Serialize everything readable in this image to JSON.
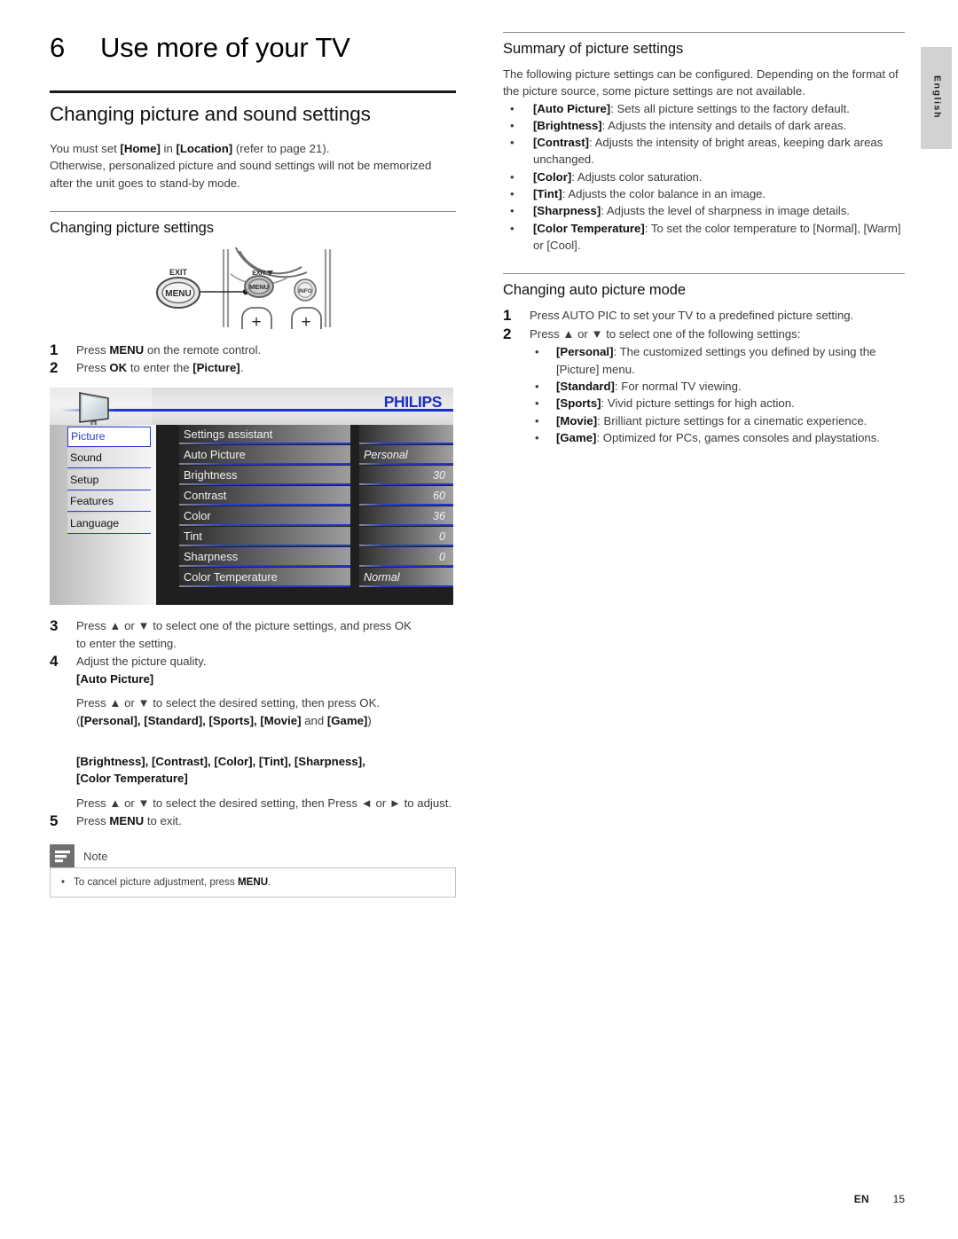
{
  "chapter": {
    "number": "6",
    "title": "Use more of your TV"
  },
  "left": {
    "section_heading": "Changing picture and sound settings",
    "intro_1_a": "You must set ",
    "intro_1_home": "[Home]",
    "intro_1_b": " in ",
    "intro_1_location": "[Location]",
    "intro_1_c": " (refer to page 21).",
    "intro_2": "Otherwise, personalized picture and sound settings will not be memorized after the unit goes to stand-by mode.",
    "sub_heading": "Changing picture settings",
    "remote": {
      "exit_label": "EXIT",
      "menu_label": "MENU",
      "exit_label_2": "EXIT",
      "menu_label_2": "MENU",
      "info_label": "INFO",
      "plus_label": "+"
    },
    "steps_top": [
      {
        "num": "1",
        "text": "Press MENU on the remote control.",
        "parts": [
          "Press ",
          "MENU",
          " on the remote control."
        ]
      },
      {
        "num": "2",
        "text": "Press OK to enter the [Picture].",
        "parts": [
          "Press ",
          "OK",
          " to enter the ",
          "[Picture]",
          "."
        ]
      }
    ],
    "osd": {
      "brand": "PHILIPS",
      "nav_items": [
        "Picture",
        "Sound",
        "Setup",
        "Features",
        "Language"
      ],
      "selected_nav": "Picture",
      "rows": [
        {
          "label": "Settings assistant",
          "value": "",
          "value_align": "left"
        },
        {
          "label": "Auto Picture",
          "value": "Personal",
          "value_align": "left"
        },
        {
          "label": "Brightness",
          "value": "30",
          "value_align": "right"
        },
        {
          "label": "Contrast",
          "value": "60",
          "value_align": "right"
        },
        {
          "label": "Color",
          "value": "36",
          "value_align": "right"
        },
        {
          "label": "Tint",
          "value": "0",
          "value_align": "right"
        },
        {
          "label": "Sharpness",
          "value": "0",
          "value_align": "right"
        },
        {
          "label": "Color Temperature",
          "value": "Normal",
          "value_align": "left"
        }
      ]
    },
    "steps_bottom": {
      "s3_num": "3",
      "s3_line1": "Press ▲ or ▼ to select one of the picture settings, and press OK",
      "s3_line2": "to enter the setting.",
      "s4_num": "4",
      "s4_line1": "Adjust the picture quality.",
      "s4_auto_picture": "[Auto Picture]",
      "s4_line2": "Press ▲ or ▼ to select the desired setting, then press OK.",
      "s4_line3_open": "(",
      "s4_modes": "[Personal], [Standard], [Sports], [Movie]",
      "s4_and": " and ",
      "s4_game": "[Game]",
      "s4_line3_close": ")",
      "s4_group_line1": "[Brightness], [Contrast], [Color], [Tint], [Sharpness],",
      "s4_group_line2": "[Color Temperature]",
      "s4_line4": "Press ▲ or ▼ to select the desired setting, then Press ◄ or ► to adjust.",
      "s5_num": "5",
      "s5_line1": "Press MENU to exit.",
      "s5_parts": [
        "Press ",
        "MENU",
        " to exit."
      ]
    },
    "note": {
      "label": "Note",
      "bullet": "•",
      "text_a": "To cancel picture adjustment, press ",
      "text_b": "MENU",
      "text_c": "."
    }
  },
  "right": {
    "summary_heading": "Summary of picture settings",
    "summary_intro": "The following picture settings can be configured. Depending on the format of the picture source, some picture settings are not available.",
    "summary_items": [
      {
        "term": "[Auto Picture]",
        "desc": ": Sets all picture settings to the factory default."
      },
      {
        "term": "[Brightness]",
        "desc": ": Adjusts the intensity and details of dark areas."
      },
      {
        "term": "[Contrast]",
        "desc": ": Adjusts the intensity of bright areas, keeping dark areas unchanged."
      },
      {
        "term": "[Color]",
        "desc": ": Adjusts color saturation."
      },
      {
        "term": "[Tint]",
        "desc": ": Adjusts the color balance in an image."
      },
      {
        "term": "[Sharpness]",
        "desc": ": Adjusts the level of sharpness in image details."
      },
      {
        "term": "[Color Temperature]",
        "desc": ": To set the color temperature to [Normal], [Warm] or [Cool]."
      }
    ],
    "auto_heading": "Changing auto picture mode",
    "auto_steps": [
      {
        "num": "1",
        "text": "Press AUTO PIC to set your TV to a predefined picture setting."
      },
      {
        "num": "2",
        "text": "Press ▲ or ▼ to select one of the following settings:"
      }
    ],
    "auto_items": [
      {
        "term": "[Personal]",
        "desc": ": The customized settings you defined by using the [Picture] menu."
      },
      {
        "term": "[Standard]",
        "desc": ": For normal TV viewing."
      },
      {
        "term": "[Sports]",
        "desc": ": Vivid picture settings for high action."
      },
      {
        "term": "[Movie]",
        "desc": ": Brilliant picture settings for a cinematic experience."
      },
      {
        "term": "[Game]",
        "desc": ": Optimized for PCs, games consoles and playstations."
      }
    ]
  },
  "side_tab": {
    "label": "English"
  },
  "footer": {
    "lang_code": "EN",
    "page_number": "15"
  },
  "colors": {
    "osd_accent_blue": "#2436d6",
    "philips_blue": "#1a2ec4",
    "note_icon_bg": "#6f6f6f",
    "side_tab_bg": "#d2d2d2"
  }
}
